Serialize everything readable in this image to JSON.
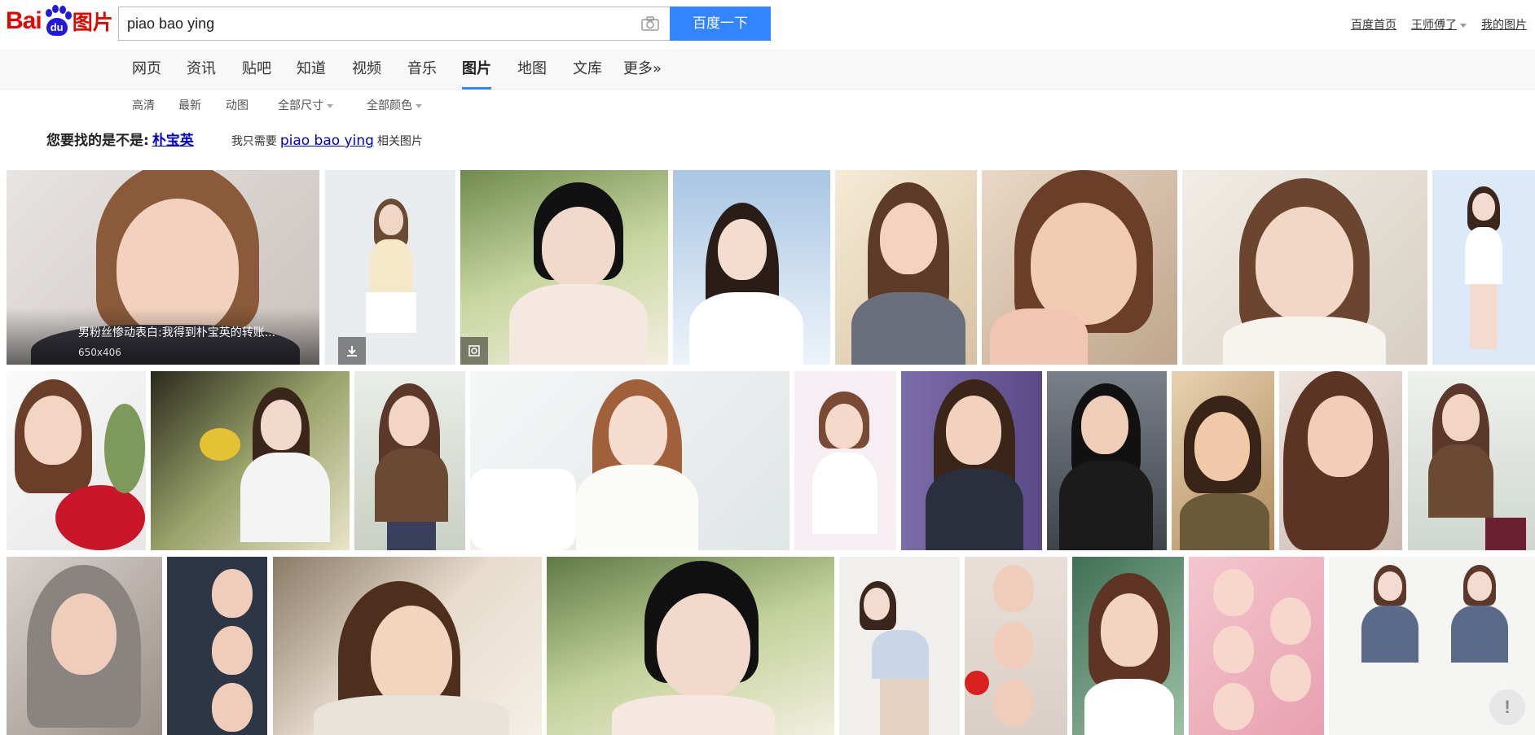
{
  "logo": {
    "bai": "Bai",
    "du": "du",
    "pian": "图片"
  },
  "search": {
    "value": "piao bao ying",
    "button_label": "百度一下",
    "camera_icon": "camera-icon"
  },
  "top_links": {
    "home": "百度首页",
    "user": "王师傅了",
    "my_images": "我的图片"
  },
  "nav": {
    "items": [
      "网页",
      "资讯",
      "贴吧",
      "知道",
      "视频",
      "音乐",
      "图片",
      "地图",
      "文库",
      "更多»"
    ],
    "active_index": 6
  },
  "filters": [
    "高清",
    "最新",
    "动图",
    "全部尺寸",
    "全部颜色"
  ],
  "suggestion": {
    "label": "您要找的是不是:",
    "link": "朴宝英",
    "only_label": "我只需要",
    "only_link": "piao bao ying",
    "only_suffix": "相关图片"
  },
  "hovered_image": {
    "caption": "男粉丝惨动表白:我得到朴宝英的转账...",
    "size": "650x406",
    "download_icon": "download-icon",
    "similar_icon": "similar-search-icon",
    "dots": ".."
  },
  "feedback": {
    "label": "!"
  },
  "colors": {
    "accent": "#3385ff",
    "brand_red": "#e10601",
    "brand_blue": "#2319dc",
    "link": "#0000cc"
  }
}
